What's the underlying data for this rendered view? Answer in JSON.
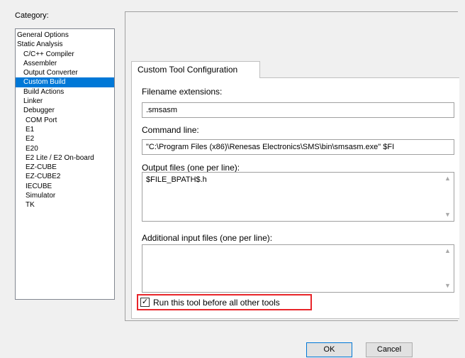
{
  "category": {
    "label": "Category:",
    "items": [
      {
        "label": "General Options",
        "level": 0,
        "selected": false
      },
      {
        "label": "Static Analysis",
        "level": 0,
        "selected": false
      },
      {
        "label": "C/C++ Compiler",
        "level": 1,
        "selected": false
      },
      {
        "label": "Assembler",
        "level": 1,
        "selected": false
      },
      {
        "label": "Output Converter",
        "level": 1,
        "selected": false
      },
      {
        "label": "Custom Build",
        "level": 1,
        "selected": true
      },
      {
        "label": "Build Actions",
        "level": 1,
        "selected": false
      },
      {
        "label": "Linker",
        "level": 1,
        "selected": false
      },
      {
        "label": "Debugger",
        "level": 1,
        "selected": false
      },
      {
        "label": "COM Port",
        "level": 2,
        "selected": false
      },
      {
        "label": "E1",
        "level": 2,
        "selected": false
      },
      {
        "label": "E2",
        "level": 2,
        "selected": false
      },
      {
        "label": "E20",
        "level": 2,
        "selected": false
      },
      {
        "label": "E2 Lite / E2 On-board",
        "level": 2,
        "selected": false
      },
      {
        "label": "EZ-CUBE",
        "level": 2,
        "selected": false
      },
      {
        "label": "EZ-CUBE2",
        "level": 2,
        "selected": false
      },
      {
        "label": "IECUBE",
        "level": 2,
        "selected": false
      },
      {
        "label": "Simulator",
        "level": 2,
        "selected": false
      },
      {
        "label": "TK",
        "level": 2,
        "selected": false
      }
    ]
  },
  "tab": {
    "label": "Custom Tool Configuration"
  },
  "filename_extensions": {
    "label": "Filename extensions:",
    "value": ".smsasm"
  },
  "command_line": {
    "label": "Command line:",
    "value": "\"C:\\Program Files (x86)\\Renesas Electronics\\SMS\\bin\\smsasm.exe\" $FI"
  },
  "output_files": {
    "label": "Output files (one per line):",
    "value": "$FILE_BPATH$.h"
  },
  "additional_input": {
    "label": "Additional input files (one per line):",
    "value": ""
  },
  "run_before": {
    "label": "Run this tool before all other tools",
    "checked": true,
    "check_glyph": "✓"
  },
  "buttons": {
    "ok": "OK",
    "cancel": "Cancel"
  },
  "colors": {
    "selection": "#0078d7",
    "highlight_border": "#e8252a"
  }
}
